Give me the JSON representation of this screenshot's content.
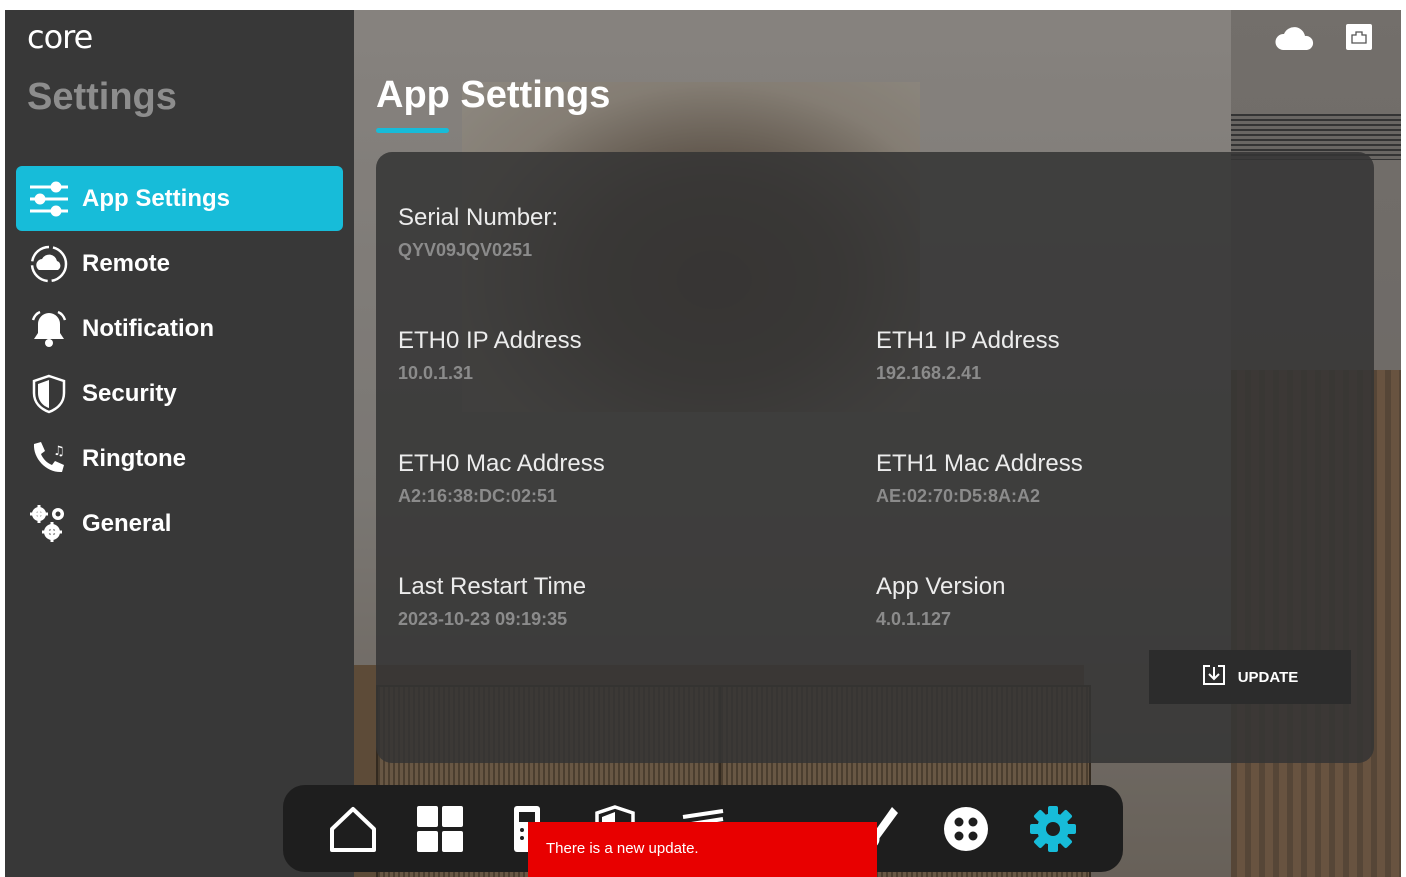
{
  "brand": {
    "logo_text": "core"
  },
  "sidebar": {
    "title": "Settings",
    "items": [
      {
        "label": "App Settings",
        "icon": "sliders-icon",
        "active": true
      },
      {
        "label": "Remote",
        "icon": "cloud-sync-icon",
        "active": false
      },
      {
        "label": "Notification",
        "icon": "bell-icon",
        "active": false
      },
      {
        "label": "Security",
        "icon": "shield-icon",
        "active": false
      },
      {
        "label": "Ringtone",
        "icon": "phone-music-icon",
        "active": false
      },
      {
        "label": "General",
        "icon": "gears-icon",
        "active": false
      }
    ]
  },
  "header": {
    "title": "App Settings",
    "icons": [
      "cloud-icon",
      "network-port-icon"
    ]
  },
  "info": {
    "serial_label": "Serial Number:",
    "serial_value": "QYV09JQV0251",
    "eth0_ip_label": "ETH0 IP Address",
    "eth0_ip_value": "10.0.1.31",
    "eth1_ip_label": "ETH1 IP Address",
    "eth1_ip_value": "192.168.2.41",
    "eth0_mac_label": "ETH0 Mac Address",
    "eth0_mac_value": "A2:16:38:DC:02:51",
    "eth1_mac_label": "ETH1 Mac Address",
    "eth1_mac_value": "AE:02:70:D5:8A:A2",
    "restart_label": "Last Restart Time",
    "restart_value": "2023-10-23 09:19:35",
    "version_label": "App Version",
    "version_value": "4.0.1.127"
  },
  "update_button": {
    "label": "UPDATE",
    "icon": "download-icon"
  },
  "dock": {
    "items": [
      "home-icon",
      "grid-icon",
      "intercom-icon",
      "security-icon",
      "blinds-icon",
      "thermostat-icon",
      "pen-icon",
      "dots-icon",
      "settings-gear-icon"
    ],
    "active": "settings-gear-icon"
  },
  "toast": {
    "message": "There is a new update."
  },
  "colors": {
    "accent": "#17bcd9",
    "sidebar_bg": "#383838",
    "toast_bg": "#e80000"
  }
}
